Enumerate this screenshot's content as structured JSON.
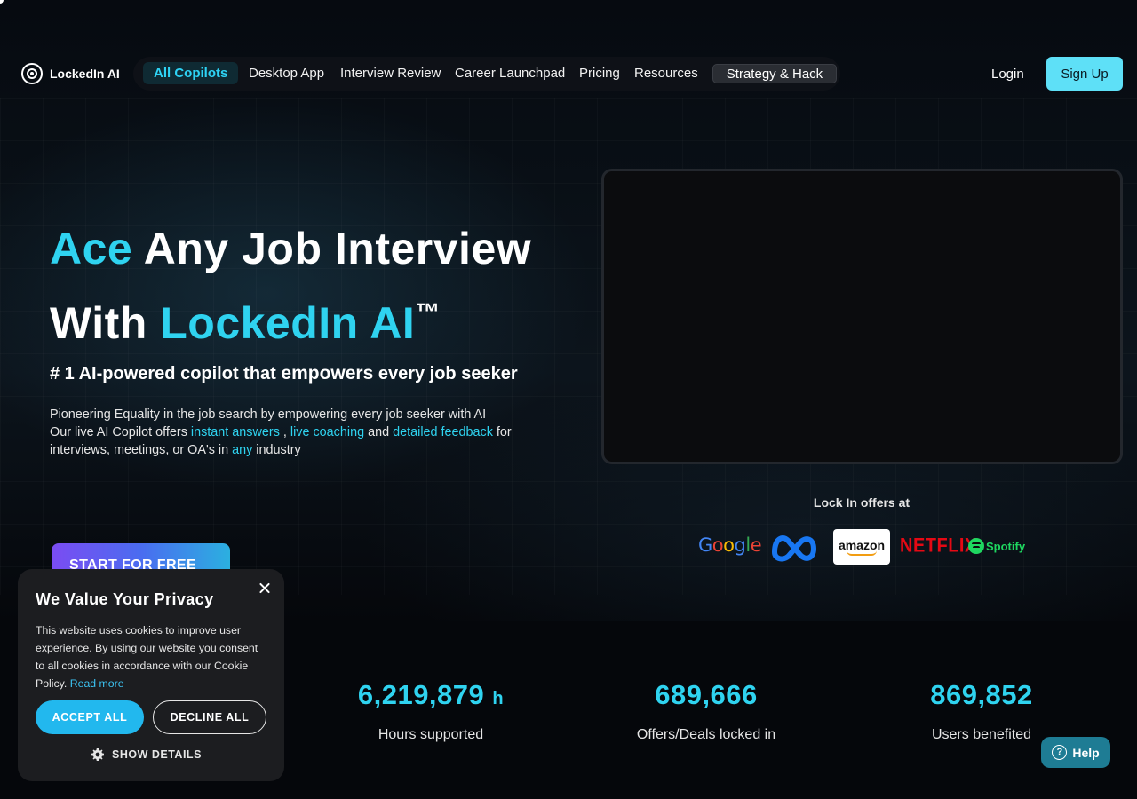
{
  "brand": {
    "name": "LockedIn AI"
  },
  "nav": {
    "items": [
      {
        "label": "All Copilots"
      },
      {
        "label": "Desktop App"
      },
      {
        "label": "Interview Review"
      },
      {
        "label": "Career Launchpad"
      },
      {
        "label": "Pricing"
      },
      {
        "label": "Resources"
      },
      {
        "label": "Strategy & Hack"
      }
    ],
    "login": "Login",
    "signup": "Sign Up"
  },
  "hero": {
    "title_ace": "Ace",
    "title_rest1": " Any Job Interview",
    "title_with": "With ",
    "title_brand": "LockedIn AI",
    "title_tm": "™",
    "subtitle_pre": "# 1 AI-powered copilot that ",
    "subtitle_em": "empowers",
    "subtitle_post": " every job seeker",
    "desc_line1": "Pioneering Equality in the job search by empowering every job seeker with AI",
    "desc_pre": "Our live AI Copilot offers ",
    "desc_hl1": "instant answers",
    "desc_sep1": " , ",
    "desc_hl2": "live coaching",
    "desc_sep2": " and ",
    "desc_hl3": "detailed feedback",
    "desc_post": " for interviews, meetings, or OA's in ",
    "desc_hl4": "any",
    "desc_end": " industry",
    "cta": "START FOR FREE"
  },
  "offers": {
    "label": "Lock In offers at",
    "brands": [
      "Google",
      "Meta",
      "amazon",
      "NETFLIX",
      "Spotify"
    ]
  },
  "stats": [
    {
      "value": "6,219,879",
      "unit": "h",
      "label": "Hours supported"
    },
    {
      "value": "689,666",
      "unit": "",
      "label": "Offers/Deals locked in"
    },
    {
      "value": "869,852",
      "unit": "",
      "label": "Users benefited"
    }
  ],
  "cookie": {
    "title": "We Value Your Privacy",
    "text": "This website uses cookies to improve user experience. By using our website you consent to all cookies in accordance with our Cookie Policy. ",
    "read_more": "Read more",
    "accept": "ACCEPT ALL",
    "decline": "DECLINE ALL",
    "details": "SHOW DETAILS"
  },
  "help": {
    "label": "Help"
  },
  "colors": {
    "accent": "#2fd3f0",
    "signup_bg": "#5ee0f7",
    "accept_bg": "#22b8ee",
    "help_bg": "#1e7c94"
  }
}
